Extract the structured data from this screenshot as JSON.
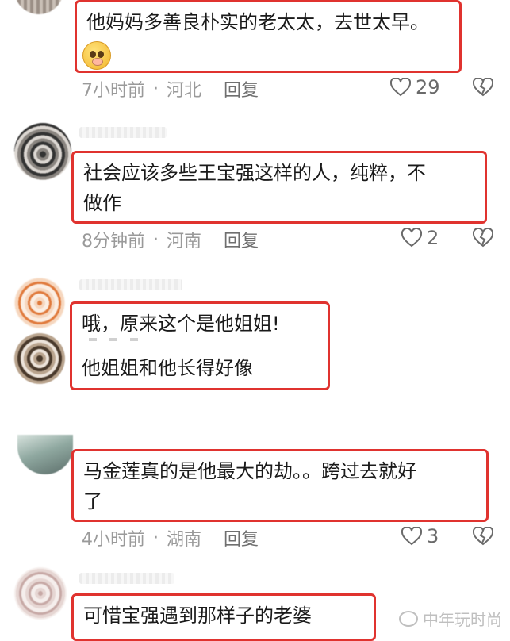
{
  "comments": [
    {
      "lines": [
        "他妈妈多善良朴实的老太太，去世太早。"
      ],
      "emoji": "pleading-face",
      "time": "7小时前",
      "location": "河北",
      "reply": "回复",
      "likes": "29"
    },
    {
      "lines": [
        "社会应该多些王宝强这样的人，纯粹，不",
        "做作"
      ],
      "time": "8分钟前",
      "location": "河南",
      "reply": "回复",
      "likes": "2"
    },
    {
      "lines": [
        "哦，原来这个是他姐姐!",
        "他姐姐和他长得好像"
      ]
    },
    {
      "lines": [
        "马金莲真的是他最大的劫。。跨过去就好",
        "了"
      ],
      "time": "4小时前",
      "location": "湖南",
      "reply": "回复",
      "likes": "3"
    },
    {
      "lines": [
        "可惜宝强遇到那样子的老婆"
      ]
    }
  ],
  "separator": "·",
  "watermark": "中年玩时尚",
  "colors": {
    "highlight_border": "#e0332f",
    "meta_text": "#9a9a9a"
  }
}
